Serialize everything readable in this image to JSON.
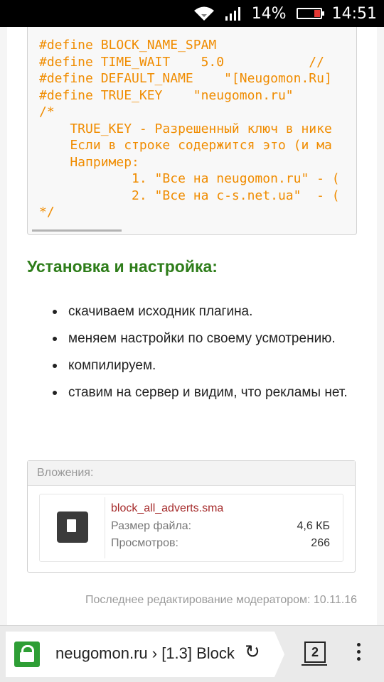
{
  "status_bar": {
    "battery": "14%",
    "time": "14:51"
  },
  "code_block": {
    "lines": [
      "#define BLOCK_NAME_SPAM",
      "#define TIME_WAIT    5.0           //",
      "#define DEFAULT_NAME    \"[Neugomon.Ru]",
      "#define TRUE_KEY    \"neugomon.ru\"",
      "/*",
      "    TRUE_KEY - Разрешенный ключ в нике",
      "    Если в строке содержится это (и ма",
      "    Например:",
      "            1. \"Все на neugomon.ru\" - (",
      "            2. \"Все на c-s.net.ua\"  - (",
      "*/"
    ]
  },
  "section_title": "Установка и настройка:",
  "steps": [
    "скачиваем исходник плагина.",
    "меняем настройки по своему усмотрению.",
    "компилируем.",
    "ставим на сервер и видим, что рекламы нет."
  ],
  "attachments": {
    "header": "Вложения:",
    "file_name": "block_all_adverts.sma",
    "size_label": "Размер файла:",
    "size_value": "4,6 КБ",
    "views_label": "Просмотров:",
    "views_value": "266"
  },
  "edit_note": "Последнее редактирование модератором: 10.11.16",
  "browser": {
    "url": "neugomon.ru › [1.3] Block",
    "tab_count": "2"
  }
}
